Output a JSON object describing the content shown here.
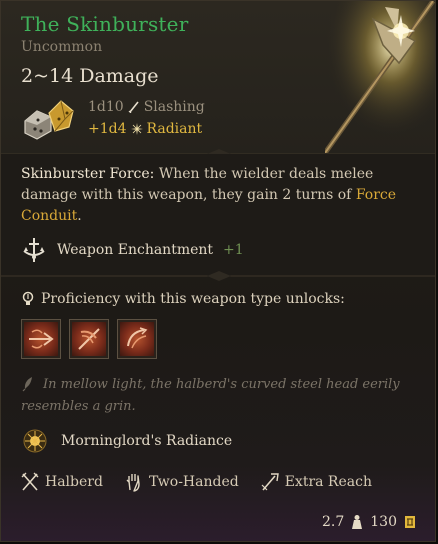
{
  "item": {
    "name": "The Skinburster",
    "rarity": "Uncommon",
    "damage_total": "2~14 Damage",
    "base_damage": {
      "dice": "1d10",
      "type": "Slashing"
    },
    "bonus_damage": {
      "dice": "+1d4",
      "type": "Radiant"
    }
  },
  "description": {
    "label": "Skinburster Force:",
    "text_1": " When the wielder deals melee damage with this weapon, they gain 2 turns of ",
    "link": "Force Conduit",
    "text_2": "."
  },
  "enchantment": {
    "label": "Weapon Enchantment",
    "value": "+1"
  },
  "proficiency": {
    "label": "Proficiency with this weapon type unlocks:",
    "actions": [
      {
        "icon": "lacerate-action-icon"
      },
      {
        "icon": "cleave-action-icon"
      },
      {
        "icon": "topple-action-icon"
      }
    ]
  },
  "flavor": "In mellow light, the halberd's curved steel head eerily resembles a grin.",
  "passive": {
    "label": "Morninglord's Radiance"
  },
  "properties": [
    {
      "label": "Halberd",
      "icon": "crossed-weapons-icon"
    },
    {
      "label": "Two-Handed",
      "icon": "hand-icon"
    },
    {
      "label": "Extra Reach",
      "icon": "reach-icon"
    }
  ],
  "footer": {
    "weight": "2.7",
    "value": "130"
  },
  "colors": {
    "rarity_uncommon": "#3fb15a",
    "radiant": "#e0b840",
    "keyword": "#d9a938",
    "enchant_bonus": "#6f8f52"
  }
}
